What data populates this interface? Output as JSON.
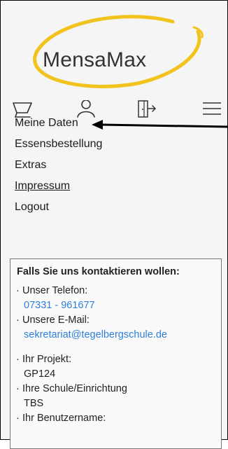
{
  "app": {
    "logo_text": "MensaMax"
  },
  "toolbar": {
    "icons": [
      "cart-icon",
      "user-icon",
      "logout-door-icon",
      "hamburger-menu-icon"
    ]
  },
  "menu": {
    "items": [
      {
        "label": "Meine Daten"
      },
      {
        "label": "Essensbestellung"
      },
      {
        "label": "Extras"
      },
      {
        "label": "Impressum"
      },
      {
        "label": "Logout"
      }
    ]
  },
  "contact": {
    "title": "Falls Sie uns kontaktieren wollen:",
    "phone_label": "Unser Telefon:",
    "phone_value": "07331 - 961677",
    "email_label": "Unsere E-Mail:",
    "email_value": "sekretariat@tegelbergschule.de",
    "project_label": "Ihr Projekt:",
    "project_value": "GP124",
    "school_label": "Ihre Schule/Einrichtung",
    "school_value": "TBS",
    "username_label": "Ihr Benutzername:"
  },
  "colors": {
    "accent_yellow": "#f2c31c",
    "link_blue": "#2e7fd8"
  }
}
